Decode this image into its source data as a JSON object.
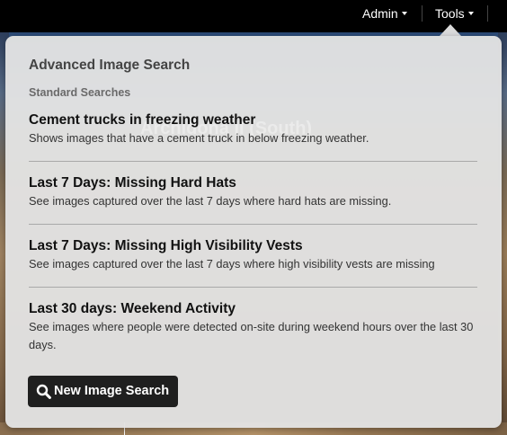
{
  "nav": {
    "admin_label": "Admin",
    "tools_label": "Tools"
  },
  "background": {
    "project_title": "Archidona II (South)"
  },
  "panel": {
    "title": "Advanced Image Search",
    "section_label": "Standard Searches",
    "searches": [
      {
        "title": "Cement trucks in freezing weather",
        "description": "Shows images that have a cement truck in below freezing weather."
      },
      {
        "title": "Last 7 Days: Missing Hard Hats",
        "description": "See images captured over the last 7 days where hard hats are missing."
      },
      {
        "title": "Last 7 Days: Missing High Visibility Vests",
        "description": "See images captured over the last 7 days where high visibility vests are missing"
      },
      {
        "title": "Last 30 days: Weekend Activity",
        "description": "See images where people were detected on-site during weekend hours over the last 30 days."
      }
    ],
    "new_search_label": "New Image Search",
    "new_search_icon": "search-icon"
  },
  "colors": {
    "topbar": "#000000",
    "panel_bg": "#e2e2e2",
    "button_bg": "#1f1f1f"
  }
}
